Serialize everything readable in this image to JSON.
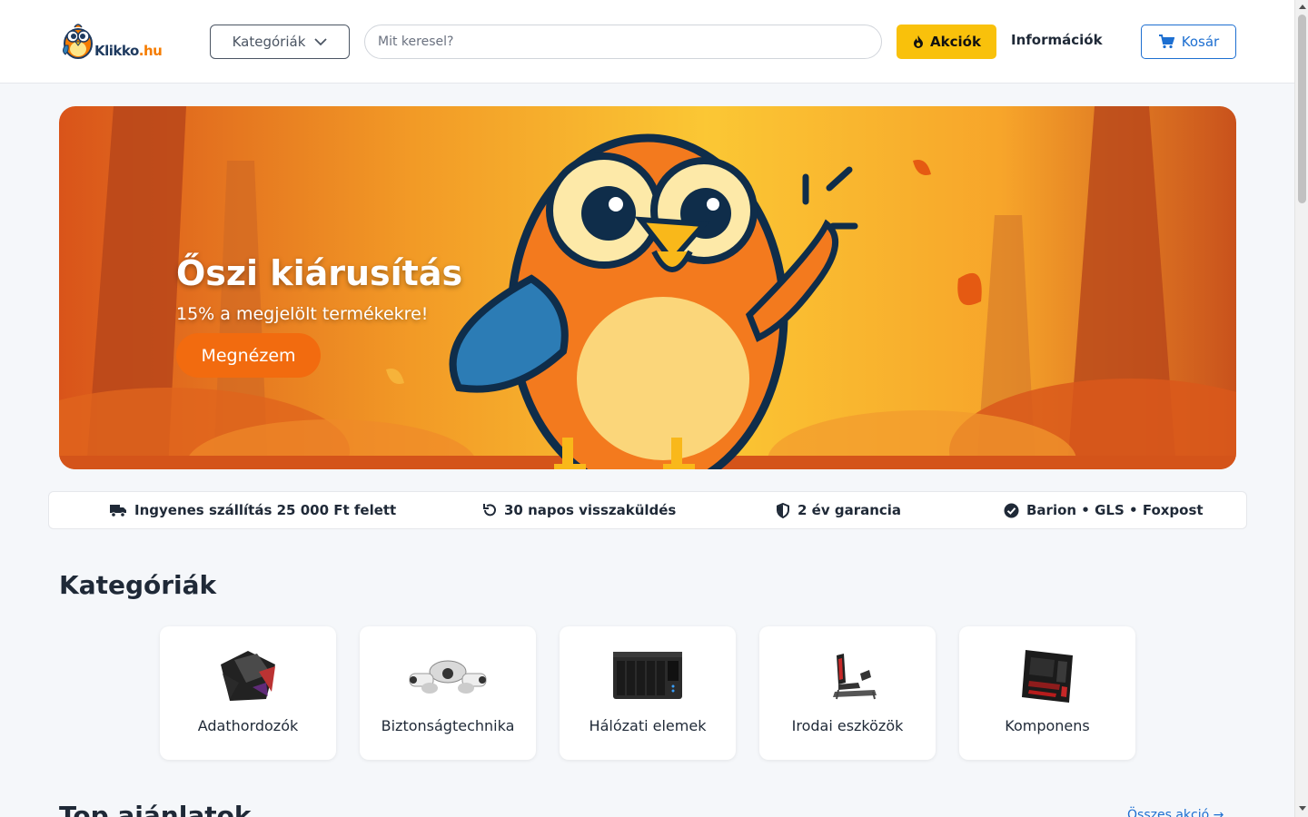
{
  "header": {
    "logo_text_main": "Klikko",
    "logo_text_tld": ".hu",
    "categories_label": "Kategóriák",
    "search_placeholder": "Mit keresel?",
    "sales_label": "Akciók",
    "info_label": "Információk",
    "cart_label": "Kosár"
  },
  "hero": {
    "title": "Őszi kiárusítás",
    "subtitle": "15% a megjelölt termékekre!",
    "cta_label": "Megnézem"
  },
  "features": [
    {
      "icon": "truck-icon",
      "label": "Ingyenes szállítás 25 000 Ft felett"
    },
    {
      "icon": "return-icon",
      "label": "30 napos visszaküldés"
    },
    {
      "icon": "shield-icon",
      "label": "2 év garancia"
    },
    {
      "icon": "check-circle-icon",
      "label": "Barion • GLS • Foxpost"
    }
  ],
  "categories": {
    "title": "Kategóriák",
    "items": [
      {
        "label": "Adathordozók",
        "icon": "storage-media-image"
      },
      {
        "label": "Biztonságtechnika",
        "icon": "security-camera-image"
      },
      {
        "label": "Hálózati elemek",
        "icon": "nas-device-image"
      },
      {
        "label": "Irodai eszközök",
        "icon": "racing-seat-image"
      },
      {
        "label": "Komponens",
        "icon": "motherboard-image"
      }
    ]
  },
  "top_offers": {
    "title": "Top ajánlatok",
    "all_link": "Összes akció →"
  },
  "colors": {
    "accent_yellow": "#f9c10b",
    "accent_blue": "#1d6fd1",
    "cta_orange": "#f26b0f"
  }
}
